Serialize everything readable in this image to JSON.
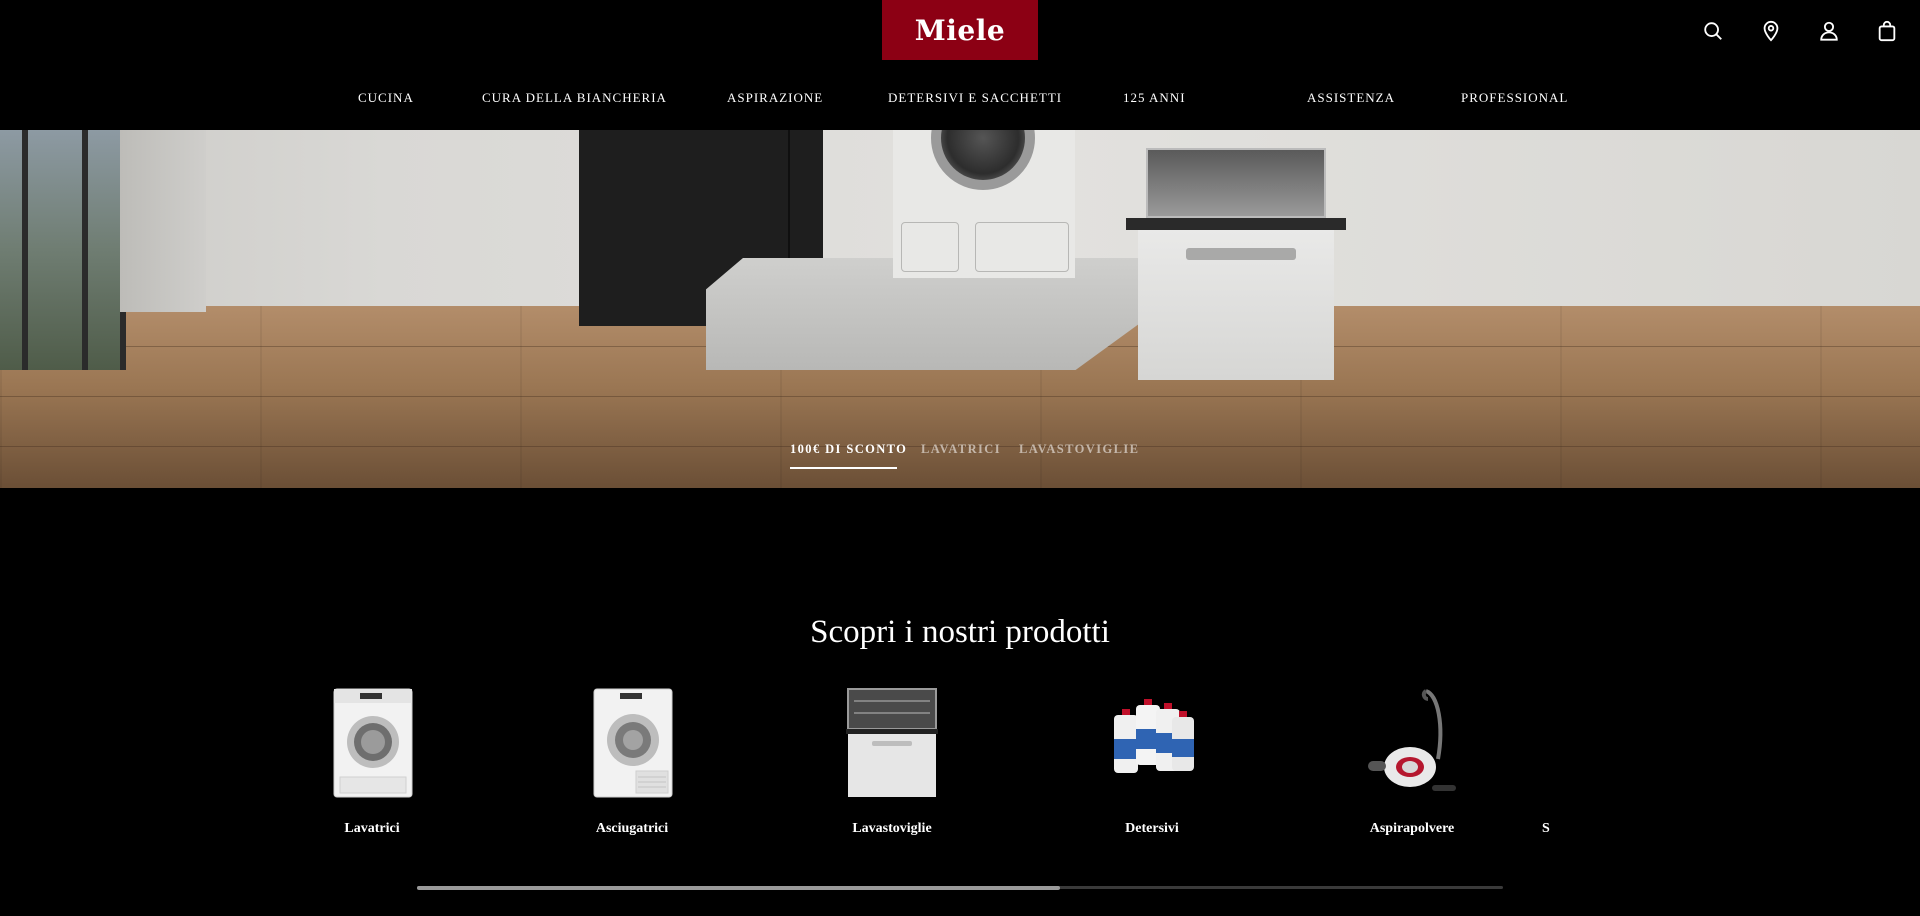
{
  "header": {
    "logo_text": "Miele",
    "logo_color": "#8c0014",
    "icons": [
      "search-icon",
      "location-pin-icon",
      "account-icon",
      "shopping-bag-icon"
    ]
  },
  "nav": {
    "items": [
      {
        "label": "CUCINA"
      },
      {
        "label": "CURA DELLA BIANCHERIA"
      },
      {
        "label": "ASPIRAZIONE"
      },
      {
        "label": "DETERSIVI E SACCHETTI"
      },
      {
        "label": "125 ANNI"
      },
      {
        "label": "ASSISTENZA"
      },
      {
        "label": "PROFESSIONAL"
      }
    ]
  },
  "hero": {
    "tabs": [
      {
        "label": "100€ DI SCONTO",
        "active": true
      },
      {
        "label": "LAVATRICI",
        "active": false
      },
      {
        "label": "LAVASTOVIGLIE",
        "active": false
      }
    ]
  },
  "products": {
    "title": "Scopri i nostri prodotti",
    "items": [
      {
        "label": "Lavatrici",
        "icon": "washing-machine-icon"
      },
      {
        "label": "Asciugatrici",
        "icon": "tumble-dryer-icon"
      },
      {
        "label": "Lavastoviglie",
        "icon": "dishwasher-icon"
      },
      {
        "label": "Detersivi",
        "icon": "detergent-bottles-icon"
      },
      {
        "label": "Aspirapolvere",
        "icon": "vacuum-cleaner-icon"
      },
      {
        "label": "S",
        "icon": ""
      }
    ],
    "scroll_position": 0.59
  }
}
